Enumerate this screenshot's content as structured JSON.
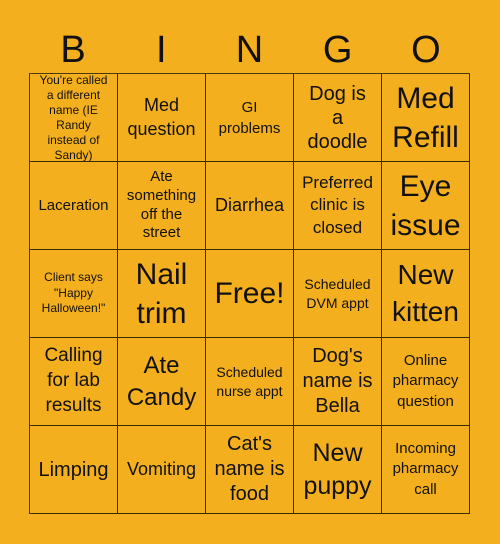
{
  "card": {
    "header": [
      "B",
      "I",
      "N",
      "G",
      "O"
    ],
    "background_color": "#F4AF1E",
    "cells": [
      [
        "You're called a different name (IE Randy instead of Sandy)",
        "Med question",
        "GI problems",
        "Dog is a doodle",
        "Med Refill"
      ],
      [
        "Laceration",
        "Ate something off the street",
        "Diarrhea",
        "Preferred clinic is closed",
        "Eye issue"
      ],
      [
        "Client says \"Happy Halloween!\"",
        "Nail trim",
        "Free!",
        "Scheduled DVM appt",
        "New kitten"
      ],
      [
        "Calling for lab results",
        "Ate Candy",
        "Scheduled nurse appt",
        "Dog's name is Bella",
        "Online pharmacy question"
      ],
      [
        "Limping",
        "Vomiting",
        "Cat's name is food",
        "New puppy",
        "Incoming pharmacy call"
      ]
    ]
  }
}
